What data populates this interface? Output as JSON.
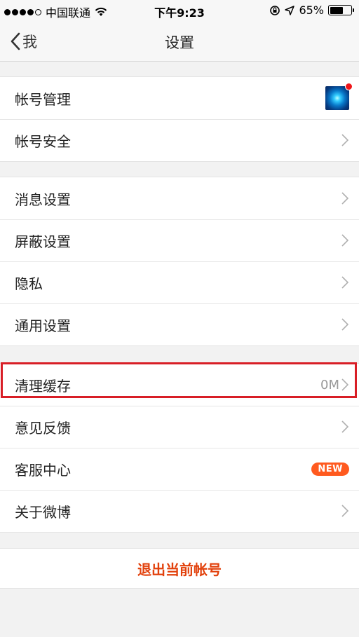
{
  "status_bar": {
    "carrier": "中国联通",
    "time": "下午9:23",
    "battery_percent": "65%",
    "battery_level": 0.65,
    "signal_bars_filled": 4,
    "signal_bars_total": 5
  },
  "nav": {
    "back_label": "我",
    "title": "设置"
  },
  "sections": {
    "account": {
      "manage": "帐号管理",
      "security": "帐号安全"
    },
    "settings": {
      "message": "消息设置",
      "block": "屏蔽设置",
      "privacy": "隐私",
      "general": "通用设置"
    },
    "misc": {
      "clear_cache": "清理缓存",
      "cache_size": "0M",
      "feedback": "意见反馈",
      "support": "客服中心",
      "support_badge": "NEW",
      "about": "关于微博"
    }
  },
  "logout_label": "退出当前帐号",
  "colors": {
    "accent": "#e2410c",
    "badge": "#ff5a1f",
    "highlight": "#d81e26"
  }
}
